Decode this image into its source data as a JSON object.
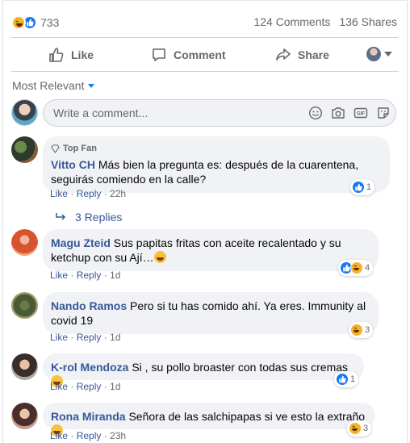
{
  "reactions": {
    "count": "733",
    "icons": [
      "haha-icon",
      "like-icon"
    ]
  },
  "stats": {
    "comments": "124 Comments",
    "shares": "136 Shares"
  },
  "actions": {
    "like": "Like",
    "comment": "Comment",
    "share": "Share"
  },
  "sort": {
    "label": "Most Relevant"
  },
  "composer": {
    "placeholder": "Write a comment...",
    "tools": [
      "emoji-icon",
      "camera-icon",
      "gif-icon",
      "sticker-icon"
    ]
  },
  "comments": [
    {
      "badge": "Top Fan",
      "name": "Vitto CH",
      "text": "Más bien la pregunta es: después de la cuarentena, seguirás comiendo en la calle?",
      "like": "Like",
      "reply": "Reply",
      "time": "22h",
      "reaction_count": "1",
      "replies": "3 Replies"
    },
    {
      "name": "Magu Zteid",
      "text": "Sus papitas fritas con aceite recalentado y su ketchup con su Ají…",
      "like": "Like",
      "reply": "Reply",
      "time": "1d",
      "reaction_count": "4"
    },
    {
      "name": "Nando Ramos",
      "text": "Pero si tu has comido ahí. Ya eres. Immunity al covid 19",
      "like": "Like",
      "reply": "Reply",
      "time": "1d",
      "reaction_count": "3"
    },
    {
      "name": "K-rol Mendoza",
      "text": "Si , su pollo broaster con todas sus cremas",
      "like": "Like",
      "reply": "Reply",
      "time": "1d",
      "reaction_count": "1"
    },
    {
      "name": "Rona Miranda",
      "text": "Señora de las salchipapas si ve esto la extraño",
      "like": "Like",
      "reply": "Reply",
      "time": "23h",
      "reaction_count": "3"
    }
  ],
  "separator": " · "
}
